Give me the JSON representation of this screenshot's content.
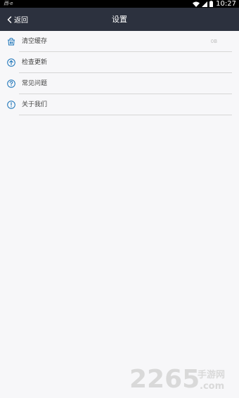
{
  "status_bar": {
    "left_text": "西·e",
    "time": "10:27",
    "icons": [
      "wifi-icon",
      "signal-icon",
      "battery-icon"
    ]
  },
  "header": {
    "back_label": "返回",
    "title": "设置",
    "background": "#2c313e"
  },
  "settings": {
    "items": [
      {
        "label": "清空缓存",
        "value": "0B",
        "icon": "clean-cache-icon"
      },
      {
        "label": "检查更新",
        "icon": "update-arrow-icon"
      },
      {
        "label": "常见问题",
        "icon": "question-icon"
      },
      {
        "label": "关于我们",
        "icon": "info-icon"
      }
    ],
    "icon_color": "#1a73b8"
  },
  "watermark": {
    "number": "2265",
    "chinese": "手游网",
    "domain": ".com"
  }
}
